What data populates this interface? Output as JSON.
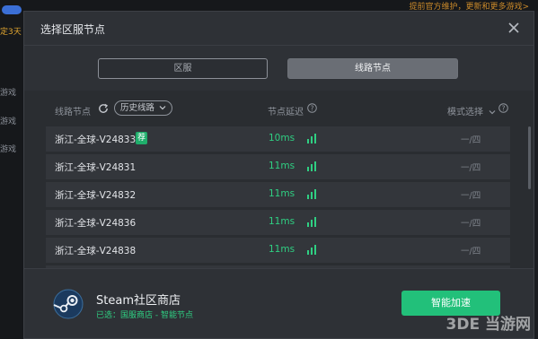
{
  "background": {
    "hint": "提前官方维护，更新和更多游戏>",
    "side_items": [
      "游戏",
      "游戏",
      "游戏"
    ]
  },
  "dialog": {
    "title": "选择区服节点",
    "tabs": {
      "region": "区服",
      "line": "线路节点"
    },
    "header": {
      "node": "线路节点",
      "history": "历史线路",
      "latency": "节点延迟",
      "mode": "模式选择"
    },
    "rows": [
      {
        "name": "浙江-全球-V24833",
        "badge": "荐",
        "latency": "10ms",
        "mode": "一/四"
      },
      {
        "name": "浙江-全球-V24831",
        "badge": "",
        "latency": "11ms",
        "mode": "一/四"
      },
      {
        "name": "浙江-全球-V24832",
        "badge": "",
        "latency": "11ms",
        "mode": "一/四"
      },
      {
        "name": "浙江-全球-V24836",
        "badge": "",
        "latency": "11ms",
        "mode": "一/四"
      },
      {
        "name": "浙江-全球-V24838",
        "badge": "",
        "latency": "11ms",
        "mode": "一/四"
      }
    ],
    "footer": {
      "game": "Steam社区商店",
      "selected": "已选：国服商店 - 智能节点",
      "button": "智能加速"
    }
  },
  "watermark": "3DE 当游网",
  "colors": {
    "accent": "#22c07a",
    "latency": "#2fcf82",
    "badge": "#1fae6b"
  },
  "icons": [
    "close-icon",
    "refresh-icon",
    "chevron-down-icon",
    "help-icon",
    "signal-icon",
    "steam-logo-icon"
  ]
}
